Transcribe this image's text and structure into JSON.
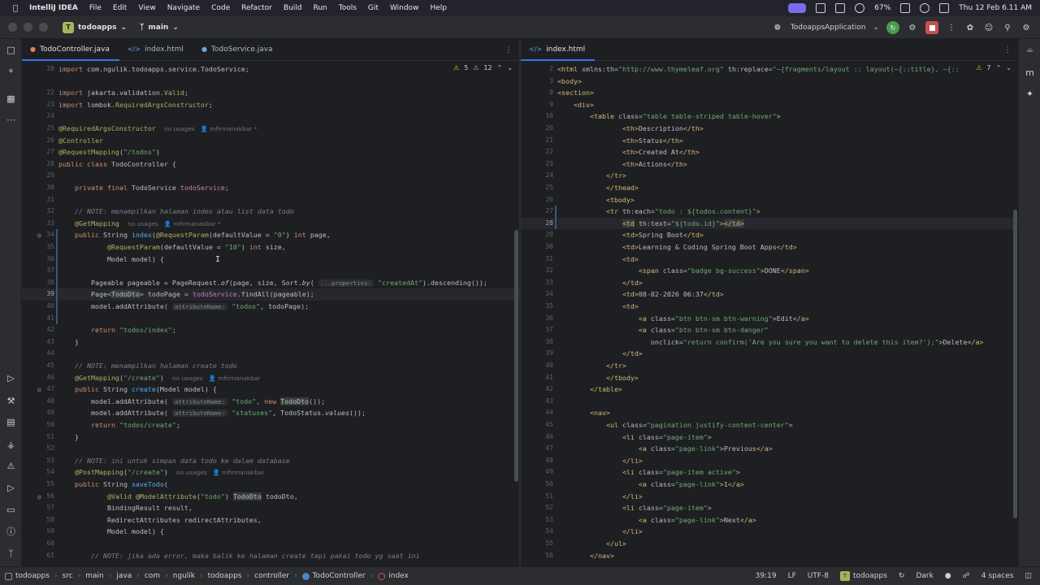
{
  "menubar": {
    "app_name": "IntelliJ IDEA",
    "items": [
      "File",
      "Edit",
      "View",
      "Navigate",
      "Code",
      "Refactor",
      "Build",
      "Run",
      "Tools",
      "Git",
      "Window",
      "Help"
    ],
    "battery": "67%",
    "datetime": "Thu 12 Feb  6.11 AM"
  },
  "titlebar": {
    "project_badge": "T",
    "project": "todoapps",
    "branch": "main",
    "run_config": "TodoappsApplication"
  },
  "left_editor": {
    "tabs": [
      {
        "label": "TodoController.java",
        "icon": "java-class-icon",
        "active": true
      },
      {
        "label": "index.html",
        "icon": "html-file-icon",
        "active": false
      },
      {
        "label": "TodoService.java",
        "icon": "java-interface-icon",
        "active": false
      }
    ],
    "inspections": {
      "warnings": "5",
      "weak_warnings": "12"
    },
    "lines": [
      {
        "n": "20",
        "html": "<span class=\"kw\">import</span> com.ngulik.todoapps.service.TodoService;"
      },
      {
        "n": "",
        "html": ""
      },
      {
        "n": "22",
        "html": "<span class=\"kw\">import</span> jakarta.validation.<span class=\"an\">Valid</span>;"
      },
      {
        "n": "23",
        "html": "<span class=\"kw\">import</span> lombok.<span class=\"an\">RequiredArgsConstructor</span>;"
      },
      {
        "n": "24",
        "html": ""
      },
      {
        "n": "25",
        "html": "<span class=\"an\">@RequiredArgsConstructor</span>  <span class=\"usage\">no usages   👤 mfirmanakbar *</span>"
      },
      {
        "n": "26",
        "html": "<span class=\"an\">@Controller</span>"
      },
      {
        "n": "27",
        "html": "<span class=\"an\">@RequestMapping</span>(<span class=\"str\">\"/todos\"</span>)"
      },
      {
        "n": "28",
        "html": "<span class=\"kw\">public class</span> <span class=\"cls\">TodoController</span> {"
      },
      {
        "n": "29",
        "html": ""
      },
      {
        "n": "30",
        "html": "    <span class=\"kw\">private final</span> TodoService <span class=\"fld\">todoService</span>;"
      },
      {
        "n": "31",
        "html": ""
      },
      {
        "n": "32",
        "html": "    <span class=\"cm\">// NOTE: menampilkan halaman index atau list data todo</span>"
      },
      {
        "n": "33",
        "html": "    <span class=\"an\">@GetMapping</span>  <span class=\"usage\">no usages   👤 mfirmanakbar *</span>"
      },
      {
        "n": "34",
        "html": "    <span class=\"kw\">public</span> String <span class=\"fn\">index</span>(<span class=\"an\">@RequestParam</span>(defaultValue = <span class=\"str\">\"0\"</span>) <span class=\"kw\">int</span> page,"
      },
      {
        "n": "35",
        "html": "            <span class=\"an\">@RequestParam</span>(defaultValue = <span class=\"str\">\"10\"</span>) <span class=\"kw\">int</span> size,"
      },
      {
        "n": "36",
        "html": "            Model model) {"
      },
      {
        "n": "37",
        "html": ""
      },
      {
        "n": "38",
        "html": "        Pageable pageable = PageRequest.<span class=\"it\">of</span>(page, size, Sort.<span class=\"it\">by</span>( <span class=\"hint\">...properties:</span> <span class=\"str\">\"createdAt\"</span>).descending());"
      },
      {
        "n": "39",
        "html": "        Page&lt;<span class=\"hl\">TodoDto</span>&gt; todoPage = <span class=\"fld\">todoService</span>.findAll(pageable);",
        "current": true
      },
      {
        "n": "40",
        "html": "        model.addAttribute( <span class=\"hint\">attributeName:</span> <span class=\"str\">\"todos\"</span>, todoPage);"
      },
      {
        "n": "41",
        "html": ""
      },
      {
        "n": "42",
        "html": "        <span class=\"kw\">return</span> <span class=\"str\">\"todos/index\"</span>;"
      },
      {
        "n": "43",
        "html": "    }"
      },
      {
        "n": "44",
        "html": ""
      },
      {
        "n": "45",
        "html": "    <span class=\"cm\">// NOTE: menampilkan halaman create todo</span>"
      },
      {
        "n": "46",
        "html": "    <span class=\"an\">@GetMapping</span>(<span class=\"str\">\"/create\"</span>)  <span class=\"usage\">no usages   👤 mfirmanakbar</span>"
      },
      {
        "n": "47",
        "html": "    <span class=\"kw\">public</span> String <span class=\"fn\">create</span>(Model model) {"
      },
      {
        "n": "48",
        "html": "        model.addAttribute( <span class=\"hint\">attributeName:</span> <span class=\"str\">\"todo\"</span>, <span class=\"kw\">new</span> <span class=\"hl\">TodoDto</span>());"
      },
      {
        "n": "49",
        "html": "        model.addAttribute( <span class=\"hint\">attributeName:</span> <span class=\"str\">\"statuses\"</span>, TodoStatus.<span class=\"it\">values</span>());"
      },
      {
        "n": "50",
        "html": "        <span class=\"kw\">return</span> <span class=\"str\">\"todos/create\"</span>;"
      },
      {
        "n": "51",
        "html": "    }"
      },
      {
        "n": "52",
        "html": ""
      },
      {
        "n": "53",
        "html": "    <span class=\"cm\">// NOTE: ini untuk simpan data todo ke dalam database</span>"
      },
      {
        "n": "54",
        "html": "    <span class=\"an\">@PostMapping</span>(<span class=\"str\">\"/create\"</span>)  <span class=\"usage\">no usages   👤 mfirmanakbar</span>"
      },
      {
        "n": "55",
        "html": "    <span class=\"kw\">public</span> String <span class=\"fn\">saveTodo</span>("
      },
      {
        "n": "56",
        "html": "            <span class=\"an\">@Valid</span> <span class=\"an\">@ModelAttribute</span>(<span class=\"str\">\"todo\"</span>) <span class=\"hl\">TodoDto</span> todoDto,"
      },
      {
        "n": "57",
        "html": "            BindingResult result,"
      },
      {
        "n": "58",
        "html": "            RedirectAttributes redirectAttributes,"
      },
      {
        "n": "59",
        "html": "            Model model) {"
      },
      {
        "n": "60",
        "html": ""
      },
      {
        "n": "61",
        "html": "        <span class=\"cm\">// NOTE: jika ada error, maka balik ke halaman create tapi pakai todo yg saat ini</span>"
      }
    ]
  },
  "right_editor": {
    "tabs": [
      {
        "label": "index.html",
        "icon": "html-file-icon",
        "active": true
      }
    ],
    "inspections": {
      "warnings": "7"
    },
    "lines": [
      {
        "n": "2",
        "html": "<span class=\"tag\">&lt;html</span> <span class=\"attr\">xmlns:th</span>=<span class=\"aval\">\"http://www.thymeleaf.org\"</span> <span class=\"attr\">th:replace</span>=<span class=\"aval\">\"~{fragments/layout :: layout(~{::title}, ~{::</span>"
      },
      {
        "n": "3",
        "html": "<span class=\"tag\">&lt;body&gt;</span>"
      },
      {
        "n": "8",
        "html": "<span class=\"tag\">&lt;section&gt;</span>"
      },
      {
        "n": "9",
        "html": "    <span class=\"tag\">&lt;div&gt;</span>"
      },
      {
        "n": "10",
        "html": "        <span class=\"tag\">&lt;table</span> <span class=\"attr\">class</span>=<span class=\"aval\">\"table table-striped table-hover\"</span><span class=\"tag\">&gt;</span>"
      },
      {
        "n": "20",
        "html": "                <span class=\"tag\">&lt;th&gt;</span>Description<span class=\"tag\">&lt;/th&gt;</span>"
      },
      {
        "n": "21",
        "html": "                <span class=\"tag\">&lt;th&gt;</span>Status<span class=\"tag\">&lt;/th&gt;</span>"
      },
      {
        "n": "22",
        "html": "                <span class=\"tag\">&lt;th&gt;</span>Created At<span class=\"tag\">&lt;/th&gt;</span>"
      },
      {
        "n": "23",
        "html": "                <span class=\"tag\">&lt;th&gt;</span>Actions<span class=\"tag\">&lt;/th&gt;</span>"
      },
      {
        "n": "24",
        "html": "            <span class=\"tag\">&lt;/tr&gt;</span>"
      },
      {
        "n": "25",
        "html": "            <span class=\"tag\">&lt;/thead&gt;</span>"
      },
      {
        "n": "26",
        "html": "            <span class=\"tag\">&lt;tbody&gt;</span>"
      },
      {
        "n": "27",
        "html": "            <span class=\"tag\">&lt;tr</span> <span class=\"attr\">th:each</span>=<span class=\"aval\">\"todo : ${todos.content}\"</span><span class=\"tag\">&gt;</span>"
      },
      {
        "n": "28",
        "html": "                <span class=\"tag hl\">&lt;td</span> <span class=\"attr\">th:text</span>=<span class=\"aval\">\"${todo.id}\"</span><span class=\"tag\">&gt;</span><span class=\"tag hl\">&lt;/td&gt;</span>",
        "current": true
      },
      {
        "n": "29",
        "html": "                <span class=\"tag\">&lt;td&gt;</span>Spring Boot<span class=\"tag\">&lt;/td&gt;</span>"
      },
      {
        "n": "30",
        "html": "                <span class=\"tag\">&lt;td&gt;</span>Learning &amp; Coding Spring Boot Apps<span class=\"tag\">&lt;/td&gt;</span>"
      },
      {
        "n": "31",
        "html": "                <span class=\"tag\">&lt;td&gt;</span>"
      },
      {
        "n": "32",
        "html": "                    <span class=\"tag\">&lt;span</span> <span class=\"attr\">class</span>=<span class=\"aval\">\"badge bg-success\"</span><span class=\"tag\">&gt;</span>DONE<span class=\"tag\">&lt;/span&gt;</span>"
      },
      {
        "n": "33",
        "html": "                <span class=\"tag\">&lt;/td&gt;</span>"
      },
      {
        "n": "34",
        "html": "                <span class=\"tag\">&lt;td&gt;</span>08-02-2026 06:37<span class=\"tag\">&lt;/td&gt;</span>"
      },
      {
        "n": "35",
        "html": "                <span class=\"tag\">&lt;td&gt;</span>"
      },
      {
        "n": "36",
        "html": "                    <span class=\"tag\">&lt;a</span> <span class=\"attr\">class</span>=<span class=\"aval\">\"btn btn-sm btn-warning\"</span><span class=\"tag\">&gt;</span>Edit<span class=\"tag\">&lt;/a&gt;</span>"
      },
      {
        "n": "37",
        "html": "                    <span class=\"tag\">&lt;a</span> <span class=\"attr\">class</span>=<span class=\"aval\">\"btn btn-sm btn-danger\"</span>"
      },
      {
        "n": "38",
        "html": "                       <span class=\"attr\">onclick</span>=<span class=\"aval\">\"return confirm('Are you sure you want to delete this item?');\"</span><span class=\"tag\">&gt;</span>Delete<span class=\"tag\">&lt;/a&gt;</span>"
      },
      {
        "n": "39",
        "html": "                <span class=\"tag\">&lt;/td&gt;</span>"
      },
      {
        "n": "40",
        "html": "            <span class=\"tag\">&lt;/tr&gt;</span>"
      },
      {
        "n": "41",
        "html": "            <span class=\"tag\">&lt;/tbody&gt;</span>"
      },
      {
        "n": "42",
        "html": "        <span class=\"tag\">&lt;/table&gt;</span>"
      },
      {
        "n": "43",
        "html": ""
      },
      {
        "n": "44",
        "html": "        <span class=\"tag\">&lt;nav&gt;</span>"
      },
      {
        "n": "45",
        "html": "            <span class=\"tag\">&lt;ul</span> <span class=\"attr\">class</span>=<span class=\"aval\">\"pagination justify-content-center\"</span><span class=\"tag\">&gt;</span>"
      },
      {
        "n": "46",
        "html": "                <span class=\"tag\">&lt;li</span> <span class=\"attr\">class</span>=<span class=\"aval\">\"page-item\"</span><span class=\"tag\">&gt;</span>"
      },
      {
        "n": "47",
        "html": "                    <span class=\"tag\">&lt;a</span> <span class=\"attr\">class</span>=<span class=\"aval\">\"page-link\"</span><span class=\"tag\">&gt;</span>Previous<span class=\"tag\">&lt;/a&gt;</span>"
      },
      {
        "n": "48",
        "html": "                <span class=\"tag\">&lt;/li&gt;</span>"
      },
      {
        "n": "49",
        "html": "                <span class=\"tag\">&lt;li</span> <span class=\"attr\">class</span>=<span class=\"aval\">\"page-item active\"</span><span class=\"tag\">&gt;</span>"
      },
      {
        "n": "50",
        "html": "                    <span class=\"tag\">&lt;a</span> <span class=\"attr\">class</span>=<span class=\"aval\">\"page-link\"</span><span class=\"tag\">&gt;</span>1<span class=\"tag\">&lt;/a&gt;</span>"
      },
      {
        "n": "51",
        "html": "                <span class=\"tag\">&lt;/li&gt;</span>"
      },
      {
        "n": "52",
        "html": "                <span class=\"tag\">&lt;li</span> <span class=\"attr\">class</span>=<span class=\"aval\">\"page-item\"</span><span class=\"tag\">&gt;</span>"
      },
      {
        "n": "53",
        "html": "                    <span class=\"tag\">&lt;a</span> <span class=\"attr\">class</span>=<span class=\"aval\">\"page-link\"</span><span class=\"tag\">&gt;</span>Next<span class=\"tag\">&lt;/a&gt;</span>"
      },
      {
        "n": "54",
        "html": "                <span class=\"tag\">&lt;/li&gt;</span>"
      },
      {
        "n": "55",
        "html": "            <span class=\"tag\">&lt;/ul&gt;</span>"
      },
      {
        "n": "56",
        "html": "        <span class=\"tag\">&lt;/nav&gt;</span>"
      }
    ]
  },
  "statusbar": {
    "breadcrumbs": [
      "todoapps",
      "src",
      "main",
      "java",
      "com",
      "ngulik",
      "todoapps",
      "controller",
      "TodoController",
      "index"
    ],
    "position": "39:19",
    "line_sep": "LF",
    "encoding": "UTF-8",
    "project_badge": "T",
    "project": "todoapps",
    "theme": "Dark",
    "indent": "4 spaces"
  }
}
